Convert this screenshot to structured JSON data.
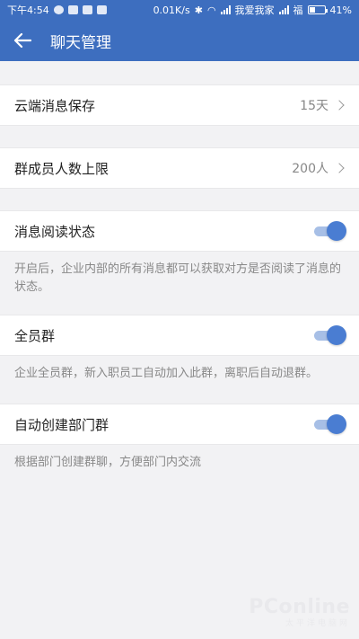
{
  "status_bar": {
    "time": "下午4:54",
    "network_speed": "0.01K/s",
    "carrier": "我爱我家",
    "carrier2": "福",
    "battery_text": "41%",
    "battery_level": 0.41,
    "left_icons": [
      "wechat-icon",
      "qq-icon",
      "notification-icon",
      "mail-icon"
    ],
    "right_icons": [
      "bluetooth-icon",
      "wifi-icon",
      "signal-icon",
      "signal-icon",
      "battery-icon"
    ]
  },
  "app_bar": {
    "title": "聊天管理",
    "back_icon": "arrow-left-icon",
    "color": "#3d6ebf"
  },
  "settings": {
    "cloud_storage": {
      "label": "云端消息保存",
      "value": "15天"
    },
    "group_limit": {
      "label": "群成员人数上限",
      "value": "200人"
    },
    "read_status": {
      "label": "消息阅读状态",
      "enabled": true,
      "description": "开启后，企业内部的所有消息都可以获取对方是否阅读了消息的状态。"
    },
    "all_staff_group": {
      "label": "全员群",
      "enabled": true,
      "description": "企业全员群，新入职员工自动加入此群，离职后自动退群。"
    },
    "auto_dept_group": {
      "label": "自动创建部门群",
      "enabled": true,
      "description": "根据部门创建群聊，方便部门内交流"
    }
  },
  "watermark": {
    "main": "PConline",
    "sub": "太平洋电脑网"
  },
  "colors": {
    "accent": "#4a7dd2",
    "toggle_track": "#a7bfe6"
  }
}
